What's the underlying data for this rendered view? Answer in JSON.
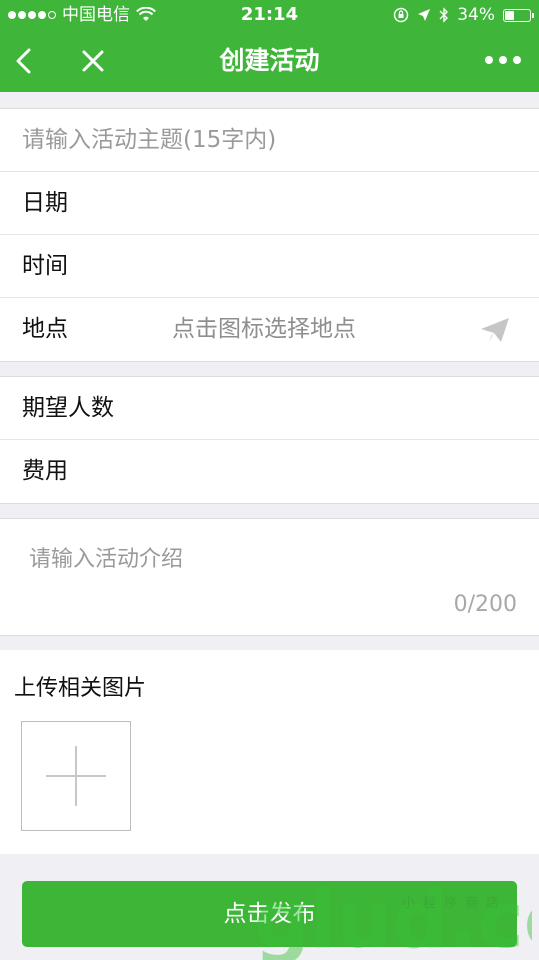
{
  "status_bar": {
    "carrier": "中国电信",
    "time": "21:14",
    "battery_text": "34%",
    "battery_level": 0.34
  },
  "nav": {
    "title": "创建活动"
  },
  "form": {
    "topic_placeholder": "请输入活动主题(15字内)",
    "date_label": "日期",
    "time_label": "时间",
    "location_label": "地点",
    "location_hint": "点击图标选择地点",
    "expected_people_label": "期望人数",
    "fee_label": "费用",
    "intro_placeholder": "请输入活动介绍",
    "intro_counter": "0/200"
  },
  "upload": {
    "title": "上传相关图片"
  },
  "publish_button": {
    "label": "点击发布"
  },
  "watermark": {
    "text": "glud.com",
    "subtext": "小程序商店"
  },
  "colors": {
    "brand_green": "#3fb53a",
    "button_green": "#3db536",
    "background": "#efeff4"
  }
}
